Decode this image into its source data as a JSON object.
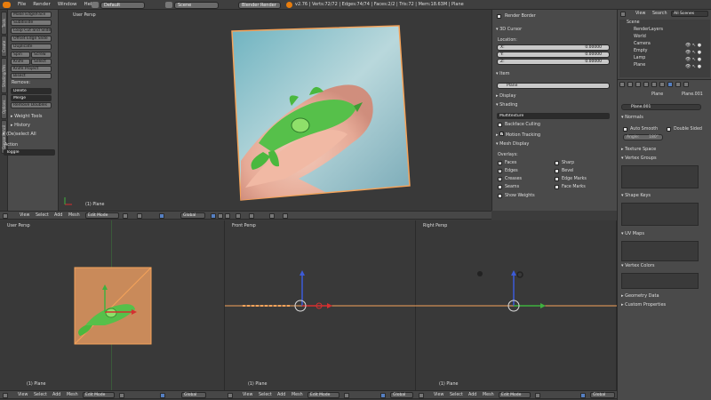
{
  "topbar": {
    "menus": [
      "File",
      "Render",
      "Window",
      "Help"
    ],
    "layout": "Default",
    "scene": "Scene",
    "engine": "Blender Render",
    "stats": "v2.76 | Verts:72/72 | Edges:74/74 | Faces:2/2 | Tris:72 | Mem:18.63M | Plane"
  },
  "tool_tabs": [
    "Tools",
    "Create",
    "Shading/UVs",
    "Options",
    "Grease Pencil"
  ],
  "toolshelf": {
    "buttons": [
      "Make Edge/Face",
      "Subdivide",
      "Loop Cut and Slide",
      "Offset Edge Slide",
      "Duplicate"
    ],
    "spin": "Spin",
    "screw": "Screw",
    "knife": "Knife",
    "select": "Select",
    "knife_project": "Knife Project",
    "bisect": "Bisect",
    "remove_label": "Remove:",
    "delete": "Delete",
    "merge": "Merge",
    "remove_doubles": "Remove Doubles",
    "weight_tools": "Weight Tools",
    "history": "History",
    "dissolve": "(De)select All",
    "action_label": "Action",
    "action_value": "Toggle"
  },
  "viewport_top": {
    "label": "User Persp",
    "object_label": "(1) Plane"
  },
  "header": {
    "view": "View",
    "select": "Select",
    "add": "Add",
    "mesh": "Mesh",
    "mode": "Edit Mode",
    "orientation": "Global"
  },
  "properties": {
    "render_border": "Render Border",
    "cursor_title": "3D Cursor",
    "location": "Location:",
    "x_label": "X:",
    "x": "0.00000",
    "y_label": "Y:",
    "y": "0.00000",
    "z_label": "Z:",
    "z": "0.00000",
    "item_title": "Item",
    "item_name": "Plane",
    "display": "Display",
    "shading": "Shading",
    "shading_mode": "Multitexture",
    "backface": "Backface Culling",
    "motion": "Motion Tracking",
    "mesh_display": "Mesh Display",
    "overlays": "Overlays:",
    "faces": "Faces",
    "sharp": "Sharp",
    "edges": "Edges",
    "bevel": "Bevel",
    "creases": "Creases",
    "edge_marks": "Edge Marks",
    "seams": "Seams",
    "face_marks": "Face Marks",
    "show_weights": "Show Weights"
  },
  "outliner": {
    "view": "View",
    "search": "Search",
    "all_scenes": "All Scenes",
    "items": [
      "Scene",
      "RenderLayers",
      "World",
      "Camera",
      "Empty",
      "Lamp",
      "Plane"
    ]
  },
  "rprops": {
    "object": "Plane",
    "mesh": "Plane.001",
    "datablock": "Plane.001",
    "normals": "Normals",
    "auto_smooth": "Auto Smooth",
    "double_sided": "Double Sided",
    "angle": "Angle:",
    "angle_val": "180°",
    "texture_space": "Texture Space",
    "vertex_groups": "Vertex Groups",
    "shape_keys": "Shape Keys",
    "uv_maps": "UV Maps",
    "vertex_colors": "Vertex Colors",
    "geometry_data": "Geometry Data",
    "custom_props": "Custom Properties"
  },
  "bottom_viewports": [
    {
      "label": "User Persp",
      "object": "(1) Plane"
    },
    {
      "label": "Front Persp",
      "object": "(1) Plane"
    },
    {
      "label": "Right Persp",
      "object": "(1) Plane"
    }
  ],
  "colors": {
    "accent": "#5680c2",
    "selection": "#f5a35a",
    "axis_x": "#d53030",
    "axis_y": "#3fb13f",
    "axis_z": "#3c5bd8"
  }
}
